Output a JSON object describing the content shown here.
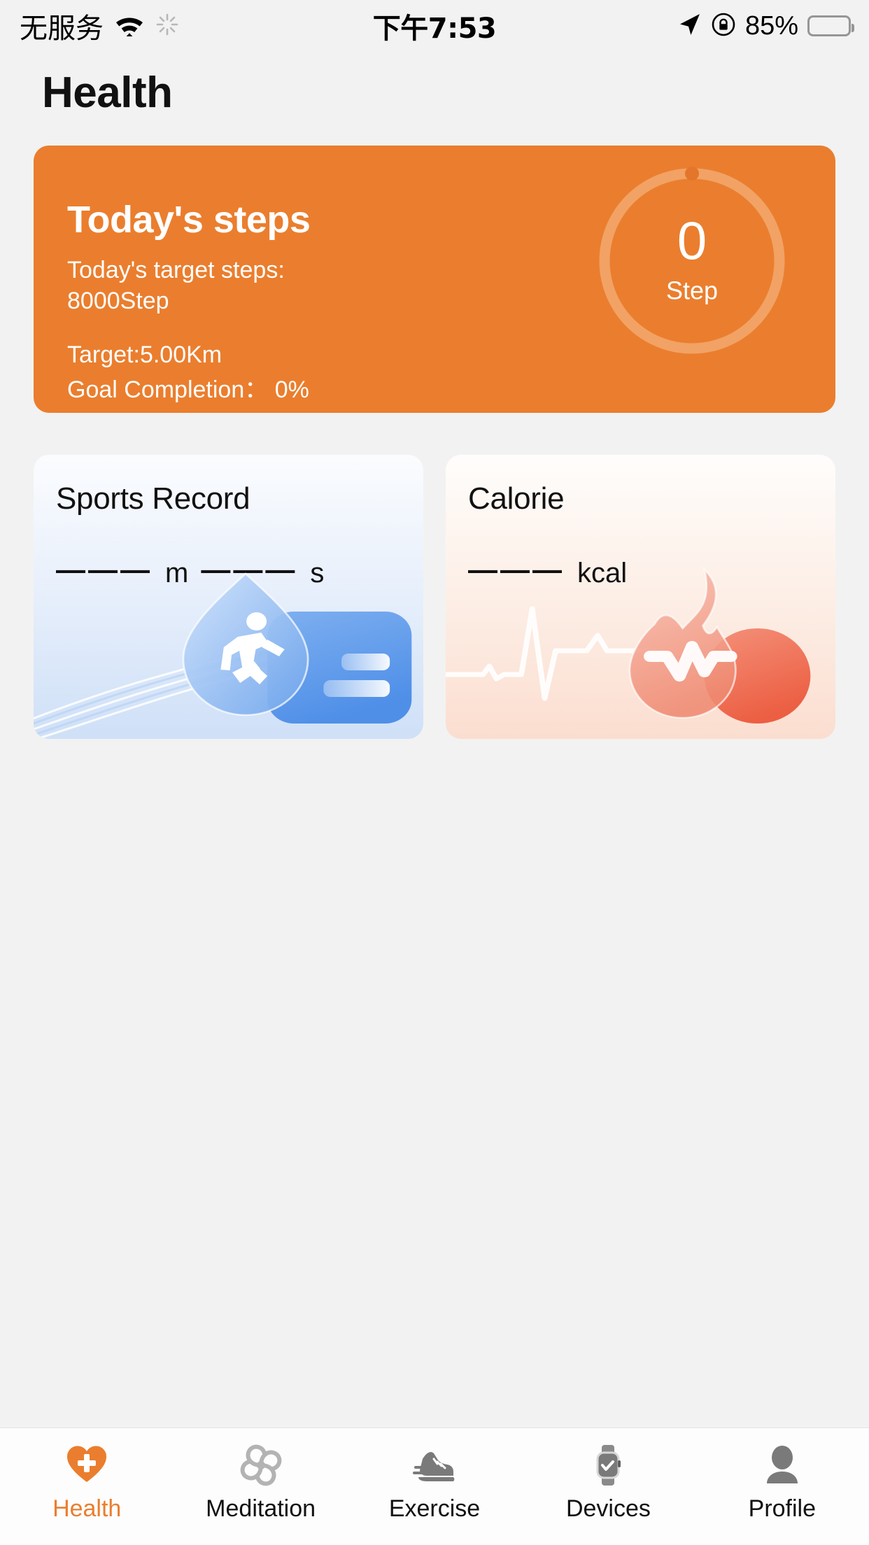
{
  "status_bar": {
    "carrier": "无服务",
    "wifi_icon": "wifi-icon",
    "spinner_icon": "activity-spinner-icon",
    "time": "下午7:53",
    "location_icon": "location-arrow-icon",
    "orientation_lock_icon": "rotation-lock-icon",
    "battery_percent": "85%",
    "battery_icon": "battery-icon"
  },
  "header": {
    "title": "Health"
  },
  "steps_card": {
    "title": "Today's steps",
    "target_label": "Today's target steps:",
    "target_value": "8000Step",
    "distance_target": "Target:5.00Km",
    "goal_completion_label": "Goal Completion：",
    "goal_completion_value": "0%",
    "ring_value": "0",
    "ring_unit": "Step",
    "progress_percent": 0,
    "bg_color": "#ea7e2e",
    "ring_track_color": "#f2a264",
    "ring_dot_color": "#e3762a"
  },
  "cards": [
    {
      "title": "Sports Record",
      "dashes_1": "———",
      "unit_1": "m",
      "dashes_2": "———",
      "unit_2": "s",
      "art_icon": "running-track-icon",
      "accent": "#4f8fe8"
    },
    {
      "title": "Calorie",
      "dashes_1": "———",
      "unit_1": "kcal",
      "art_icon": "flame-heartbeat-icon",
      "accent": "#ee6a4d"
    }
  ],
  "tabbar": {
    "active_color": "#ea7e2e",
    "inactive_color": "#111111",
    "items": [
      {
        "label": "Health",
        "icon": "heart-plus-icon",
        "active": true
      },
      {
        "label": "Meditation",
        "icon": "spiral-icon",
        "active": false
      },
      {
        "label": "Exercise",
        "icon": "sneaker-icon",
        "active": false
      },
      {
        "label": "Devices",
        "icon": "smartwatch-icon",
        "active": false
      },
      {
        "label": "Profile",
        "icon": "person-icon",
        "active": false
      }
    ]
  }
}
